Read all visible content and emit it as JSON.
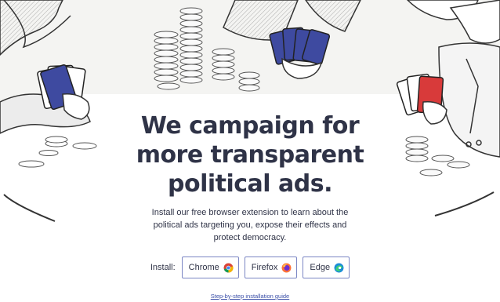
{
  "hero": {
    "headline_lines": [
      "We campaign for",
      "more transparent",
      "political ads."
    ],
    "subtext_lines": [
      "Install our free browser extension to learn about the",
      "political ads targeting you, expose their effects and",
      "protect democracy."
    ]
  },
  "install": {
    "label": "Install:",
    "buttons": [
      {
        "label": "Chrome",
        "icon": "chrome-icon"
      },
      {
        "label": "Firefox",
        "icon": "firefox-icon"
      },
      {
        "label": "Edge",
        "icon": "edge-icon"
      }
    ],
    "guide_link": "Step-by-step installation guide"
  },
  "colors": {
    "text": "#2f3347",
    "button_border": "#7b86c4",
    "link": "#3b4fa8",
    "card_blue": "#3e4aa0",
    "card_red": "#d83a3a"
  }
}
